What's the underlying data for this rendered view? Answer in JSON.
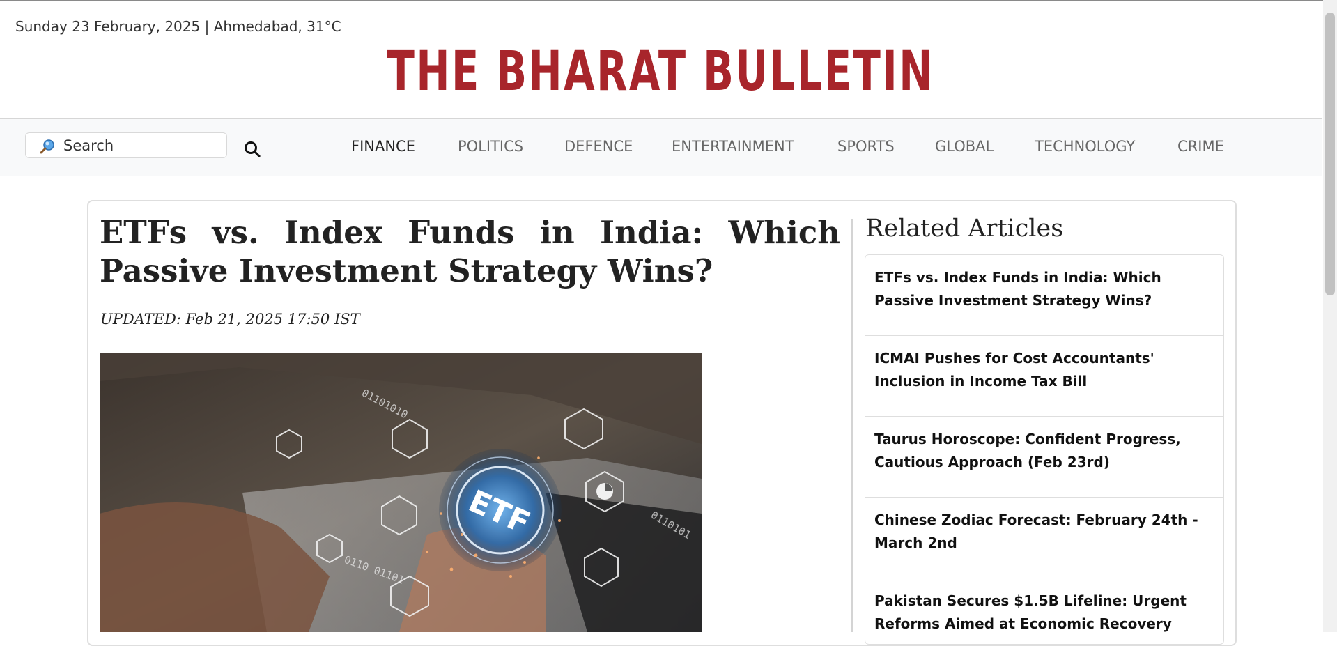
{
  "header": {
    "dateline": "Sunday 23 February, 2025 | Ahmedabad, 31°C",
    "masthead": "THE BHARAT BULLETIN"
  },
  "nav": {
    "search_placeholder": "Search",
    "items": [
      "FINANCE",
      "POLITICS",
      "DEFENCE",
      "ENTERTAINMENT",
      "SPORTS",
      "GLOBAL",
      "TECHNOLOGY",
      "CRIME"
    ],
    "active": "FINANCE"
  },
  "article": {
    "title": "ETFs vs. Index Funds in India: Which Passive Investment Strategy Wins?",
    "updated": "UPDATED: Feb 21, 2025 17:50 IST",
    "image_label": "ETF"
  },
  "sidebar": {
    "heading": "Related Articles",
    "items": [
      {
        "title": "ETFs vs. Index Funds in India: Which Passive Investment Strategy Wins?"
      },
      {
        "title": "ICMAI Pushes for Cost Accountants' Inclusion in Income Tax Bill"
      },
      {
        "title": "Taurus Horoscope: Confident Progress, Cautious Approach (Feb 23rd)"
      },
      {
        "title": "Chinese Zodiac Forecast: February 24th - March 2nd"
      },
      {
        "title": "Pakistan Secures $1.5B Lifeline: Urgent Reforms Aimed at Economic Recovery"
      }
    ]
  },
  "colors": {
    "brand": "#a8252b",
    "text": "#222222",
    "nav_background": "#f8f9fa"
  }
}
